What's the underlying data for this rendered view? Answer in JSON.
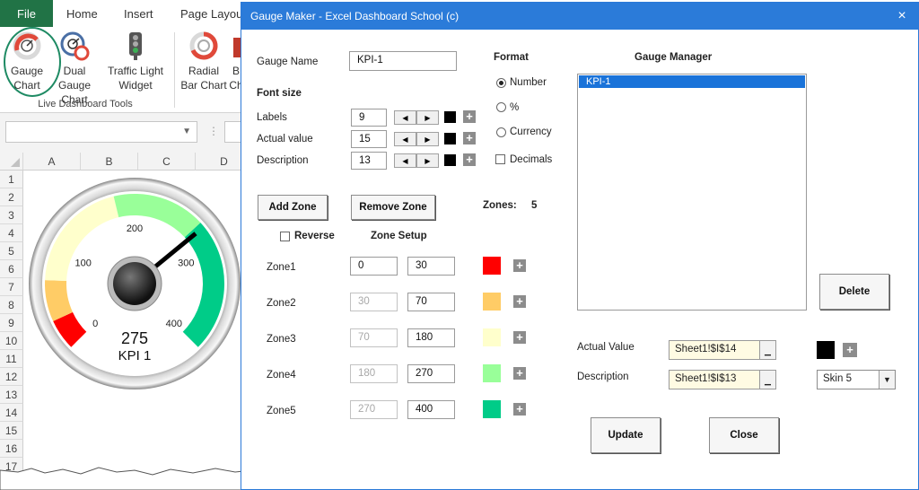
{
  "excel": {
    "tabs": [
      "File",
      "Home",
      "Insert",
      "Page Layout"
    ],
    "ribbon_buttons": [
      {
        "line1": "Gauge",
        "line2": "Chart",
        "icon": "gauge-chart-icon"
      },
      {
        "line1": "Dual Gauge",
        "line2": "Chart",
        "icon": "dual-gauge-icon"
      },
      {
        "line1": "Traffic Light",
        "line2": "Widget",
        "icon": "traffic-light-icon"
      },
      {
        "line1": "Radial",
        "line2": "Bar Chart",
        "icon": "radial-bar-icon"
      },
      {
        "line1": "B",
        "line2": "Ch",
        "icon": "bar-chart-icon"
      }
    ],
    "group_label": "Live Dashboard Tools",
    "columns": [
      "A",
      "B",
      "C",
      "D"
    ],
    "rows": [
      "1",
      "2",
      "3",
      "4",
      "5",
      "6",
      "7",
      "8",
      "9",
      "10",
      "11",
      "12",
      "13",
      "14",
      "15",
      "16",
      "17"
    ]
  },
  "gauge": {
    "value": "275",
    "label": "KPI 1",
    "ticks": [
      "0",
      "100",
      "200",
      "300",
      "400"
    ],
    "min": 0,
    "max": 400,
    "needle_value": 275,
    "zone_colors": [
      "#ff0000",
      "#ffcc66",
      "#ffffcc",
      "#99ff99",
      "#00cc88"
    ]
  },
  "dialog": {
    "title": "Gauge Maker - Excel Dashboard School (c)",
    "close_icon": "×",
    "gauge_name_label": "Gauge Name",
    "gauge_name_value": "KPI-1",
    "font_size_heading": "Font size",
    "font_rows": [
      {
        "label": "Labels",
        "value": "9"
      },
      {
        "label": "Actual value",
        "value": "15"
      },
      {
        "label": "Description",
        "value": "13"
      }
    ],
    "format_heading": "Format",
    "format_options": [
      "Number",
      "%",
      "Currency"
    ],
    "format_selected": "Number",
    "decimals_label": "Decimals",
    "add_zone": "Add Zone",
    "remove_zone": "Remove Zone",
    "zones_label": "Zones:",
    "zones_count": "5",
    "reverse_label": "Reverse",
    "zone_setup_label": "Zone Setup",
    "zones": [
      {
        "label": "Zone1",
        "from": "0",
        "to": "30",
        "color": "#ff0000"
      },
      {
        "label": "Zone2",
        "from": "30",
        "to": "70",
        "color": "#ffcc66"
      },
      {
        "label": "Zone3",
        "from": "70",
        "to": "180",
        "color": "#ffffcc"
      },
      {
        "label": "Zone4",
        "from": "180",
        "to": "270",
        "color": "#99ff99"
      },
      {
        "label": "Zone5",
        "from": "270",
        "to": "400",
        "color": "#00cc88"
      }
    ],
    "manager_heading": "Gauge Manager",
    "manager_items": [
      "KPI-1"
    ],
    "delete": "Delete",
    "actual_value_label": "Actual Value",
    "actual_value_ref": "Sheet1!$I$14",
    "description_label": "Description",
    "description_ref": "Sheet1!$I$13",
    "skin_value": "Skin 5",
    "update": "Update",
    "close": "Close"
  }
}
